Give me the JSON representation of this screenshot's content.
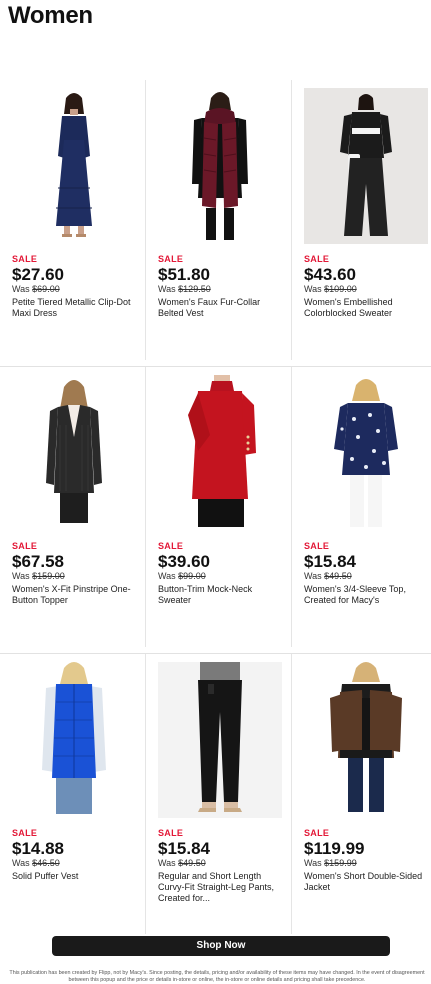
{
  "page": {
    "title": "Women"
  },
  "products": [
    {
      "sale_label": "SALE",
      "price": "$27.60",
      "was_prefix": "Was ",
      "was_price": "$69.00",
      "name": "Petite Tiered Metallic Clip-Dot Maxi Dress",
      "image": "navy maxi dress"
    },
    {
      "sale_label": "SALE",
      "price": "$51.80",
      "was_prefix": "Was ",
      "was_price": "$129.50",
      "name": "Women's Faux Fur-Collar Belted Vest",
      "image": "burgundy quilted vest"
    },
    {
      "sale_label": "SALE",
      "price": "$43.60",
      "was_prefix": "Was ",
      "was_price": "$109.00",
      "name": "Women's Embellished Colorblocked Sweater",
      "image": "black and white sweater"
    },
    {
      "sale_label": "SALE",
      "price": "$67.58",
      "was_prefix": "Was ",
      "was_price": "$159.00",
      "name": "Women's X-Fit Pinstripe One-Button Topper",
      "image": "black pinstripe blazer"
    },
    {
      "sale_label": "SALE",
      "price": "$39.60",
      "was_prefix": "Was ",
      "was_price": "$99.00",
      "name": "Button-Trim Mock-Neck Sweater",
      "image": "red mock-neck sweater"
    },
    {
      "sale_label": "SALE",
      "price": "$15.84",
      "was_prefix": "Was ",
      "was_price": "$49.50",
      "name": "Women's 3/4-Sleeve Top, Created for Macy's",
      "image": "navy floral top"
    },
    {
      "sale_label": "SALE",
      "price": "$14.88",
      "was_prefix": "Was ",
      "was_price": "$46.50",
      "name": "Solid Puffer Vest",
      "image": "blue puffer vest"
    },
    {
      "sale_label": "SALE",
      "price": "$15.84",
      "was_prefix": "Was ",
      "was_price": "$49.50",
      "name": "Regular and Short Length Curvy-Fit Straight-Leg Pants, Created for...",
      "image": "black straight-leg pants"
    },
    {
      "sale_label": "SALE",
      "price": "$119.99",
      "was_prefix": "Was ",
      "was_price": "$159.99",
      "name": "Women's Short Double-Sided Jacket",
      "image": "brown shearling jacket"
    }
  ],
  "shop_button": {
    "label": "Shop Now"
  },
  "disclaimer": "This publication has been created by Flipp, not by Macy's. Since posting, the details, pricing and/or availability of these items may have changed. In the event of disagreement between this popup and the price or details in-store or online, the in-store or online details and pricing shall take precedence.",
  "colors": {
    "sale": "#e31837",
    "button_bg": "#1a1a1a",
    "text": "#111111"
  }
}
